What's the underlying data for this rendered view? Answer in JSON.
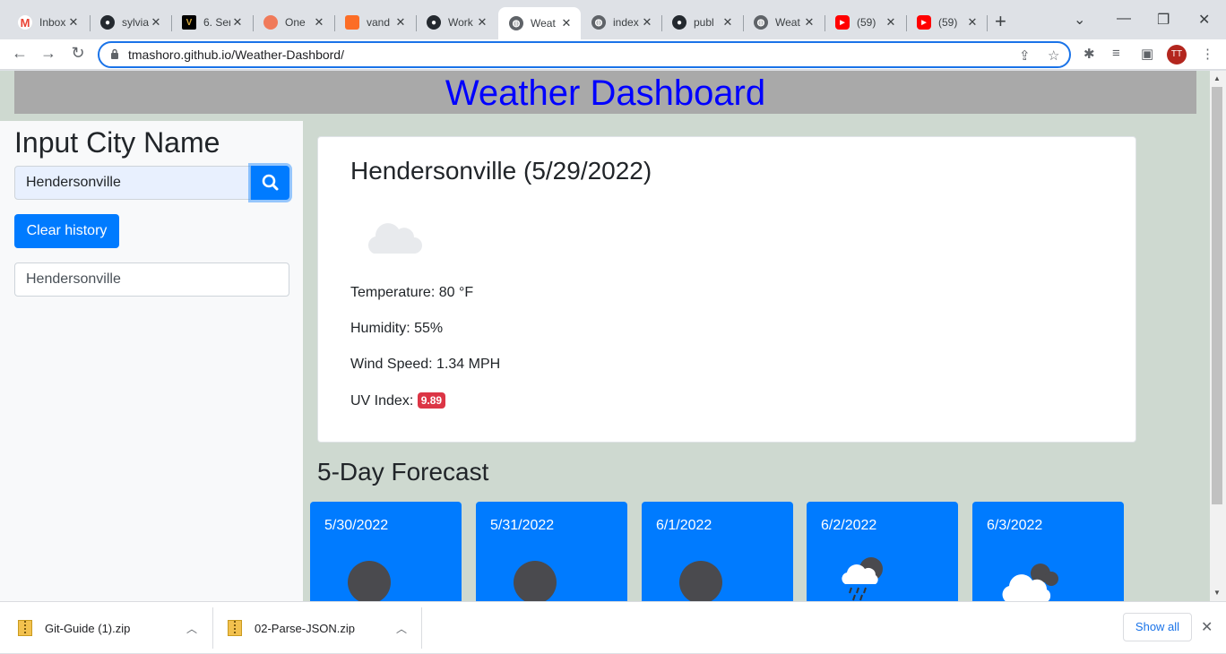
{
  "browser": {
    "tabs": [
      {
        "title": "Inbox",
        "icon": "gmail-icon"
      },
      {
        "title": "sylvia",
        "icon": "github-icon"
      },
      {
        "title": "6. Ser",
        "icon": "vanderbilt-icon"
      },
      {
        "title": "One",
        "icon": "app-icon"
      },
      {
        "title": "vand",
        "icon": "gitlab-icon"
      },
      {
        "title": "Work",
        "icon": "github-icon"
      },
      {
        "title": "Weat",
        "icon": "globe-icon"
      },
      {
        "title": "index",
        "icon": "globe-icon"
      },
      {
        "title": "publ",
        "icon": "github-icon"
      },
      {
        "title": "Weat",
        "icon": "globe-icon"
      },
      {
        "title": "(59)",
        "icon": "youtube-icon"
      },
      {
        "title": "(59)",
        "icon": "youtube-icon"
      }
    ],
    "active_tab_index": 6,
    "url": "tmashoro.github.io/Weather-Dashbord/",
    "profile_initials": "TT"
  },
  "page": {
    "title": "Weather Dashboard",
    "sidebar": {
      "heading": "Input City Name",
      "search_value": "Hendersonville",
      "clear_label": "Clear history",
      "history": [
        "Hendersonville"
      ]
    },
    "current": {
      "heading": "Hendersonville (5/29/2022)",
      "temperature": "Temperature: 80 °F",
      "humidity": "Humidity: 55%",
      "wind": "Wind Speed: 1.34 MPH",
      "uv_label": "UV Index:",
      "uv_value": "9.89",
      "uv_color": "#dc3545"
    },
    "forecast_title": "5-Day Forecast",
    "forecast": [
      {
        "date": "5/30/2022",
        "icon": "moon-icon"
      },
      {
        "date": "5/31/2022",
        "icon": "moon-icon"
      },
      {
        "date": "6/1/2022",
        "icon": "moon-icon"
      },
      {
        "date": "6/2/2022",
        "icon": "rain-cloud-icon"
      },
      {
        "date": "6/3/2022",
        "icon": "cloudy-icon"
      }
    ]
  },
  "downloads": {
    "items": [
      "Git-Guide (1).zip",
      "02-Parse-JSON.zip"
    ],
    "show_all": "Show all"
  }
}
